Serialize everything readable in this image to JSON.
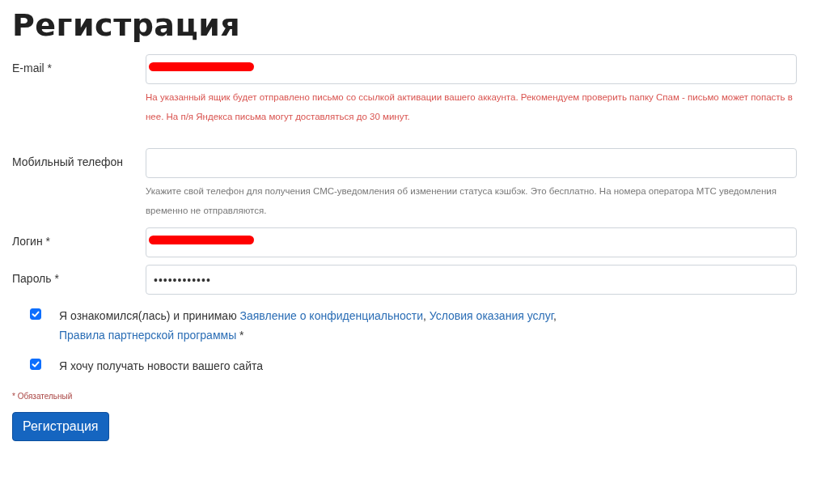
{
  "title": "Регистрация",
  "fields": [
    {
      "label": "E-mail *",
      "redacted": true,
      "hint": "На указанный ящик будет отправлено письмо со ссылкой активации вашего аккаунта. Рекомендуем проверить папку Спам - письмо может попасть в нее. На п/я Яндекса письма могут доставляться до 30 минут.",
      "kind": "warning"
    },
    {
      "label": "Мобильный телефон",
      "redacted": false,
      "hint": "Укажите свой телефон для получения СМС-уведомления об изменении статуса кэшбэк. Это бесплатно. На номера оператора МТС уведомления временно не отправляются.",
      "kind": "note"
    },
    {
      "label": "Логин *",
      "kind": "plain",
      "redacted": true
    },
    {
      "label": "Пароль *",
      "kind": "password",
      "redacted": false,
      "value": "••••••••••••"
    }
  ],
  "checkboxes": [
    {
      "checked": true,
      "parts": [
        {
          "kind": "text",
          "text": "Я ознакомился(лась) и принимаю "
        },
        {
          "kind": "link",
          "text": "Заявление о конфиденциальности"
        },
        {
          "kind": "text",
          "text": ", "
        },
        {
          "kind": "link",
          "text": "Условия оказания услуг"
        },
        {
          "kind": "text",
          "text": ", "
        },
        {
          "kind": "link",
          "text": "Правила партнерской программы"
        },
        {
          "kind": "text",
          "text": " *"
        }
      ]
    },
    {
      "checked": true,
      "parts": [
        {
          "kind": "text",
          "text": "Я хочу получать новости вашего сайта"
        }
      ]
    }
  ],
  "required_note": "* Обязательный",
  "submit": "Регистрация"
}
